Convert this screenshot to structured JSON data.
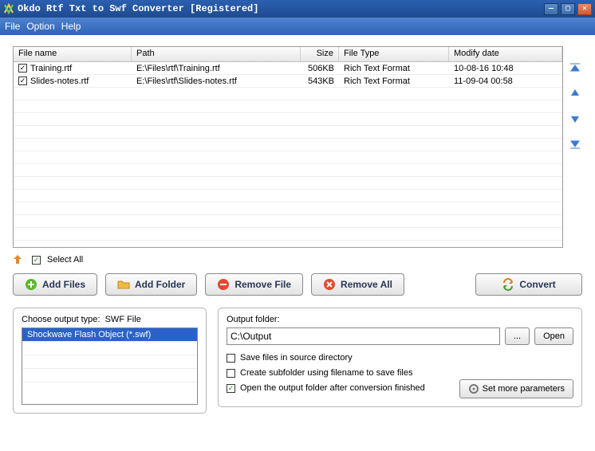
{
  "titlebar": {
    "title": "Okdo Rtf Txt to Swf Converter [Registered]"
  },
  "menu": {
    "file": "File",
    "option": "Option",
    "help": "Help"
  },
  "table": {
    "headers": {
      "name": "File name",
      "path": "Path",
      "size": "Size",
      "type": "File Type",
      "date": "Modify date"
    },
    "rows": [
      {
        "checked": true,
        "name": "Training.rtf",
        "path": "E:\\Files\\rtf\\Training.rtf",
        "size": "506KB",
        "type": "Rich Text Format",
        "date": "10-08-16 10:48"
      },
      {
        "checked": true,
        "name": "Slides-notes.rtf",
        "path": "E:\\Files\\rtf\\Slides-notes.rtf",
        "size": "543KB",
        "type": "Rich Text Format",
        "date": "11-09-04 00:58"
      }
    ]
  },
  "selectAll": {
    "label": "Select All",
    "checked": true
  },
  "buttons": {
    "addFiles": "Add Files",
    "addFolder": "Add Folder",
    "removeFile": "Remove File",
    "removeAll": "Remove All",
    "convert": "Convert",
    "browse": "...",
    "open": "Open",
    "more": "Set more parameters"
  },
  "outputType": {
    "label": "Choose output type:",
    "current": "SWF File",
    "items": [
      "Shockwave Flash Object (*.swf)"
    ]
  },
  "outputFolder": {
    "label": "Output folder:",
    "value": "C:\\Output"
  },
  "options": {
    "saveInSource": {
      "label": "Save files in source directory",
      "checked": false
    },
    "createSubfolder": {
      "label": "Create subfolder using filename to save files",
      "checked": false
    },
    "openAfter": {
      "label": "Open the output folder after conversion finished",
      "checked": true
    }
  }
}
